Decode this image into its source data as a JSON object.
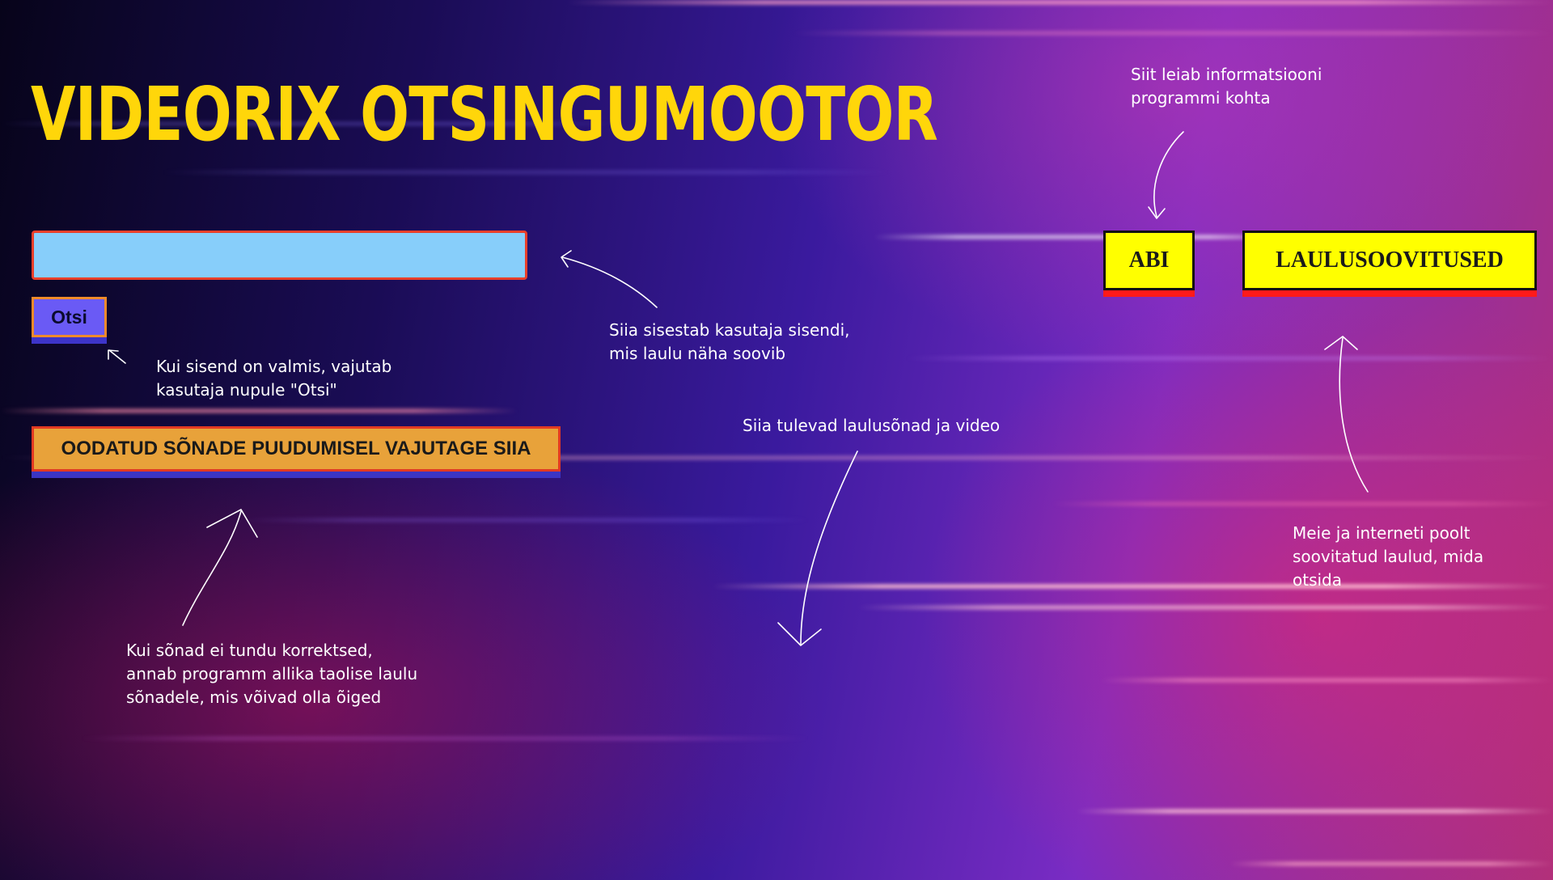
{
  "page": {
    "title": "VIDEORIX OTSINGUMOOTOR"
  },
  "search": {
    "value": "",
    "placeholder": ""
  },
  "buttons": {
    "search_label": "Otsi",
    "missing_words_label": "OODATUD SÕNADE PUUDUMISEL VAJUTAGE SIIA",
    "help_label": "ABI",
    "song_suggestions_label": "LAULUSOOVITUSED"
  },
  "annotations": {
    "help_info": [
      "Siit leiab informatsiooni",
      "programmi kohta"
    ],
    "search_input": [
      "Siia sisestab kasutaja sisendi,",
      "mis laulu näha soovib"
    ],
    "search_button": [
      "Kui sisend on valmis, vajutab",
      "kasutaja nupule \"Otsi\""
    ],
    "lyrics_video": [
      "Siia tulevad laulusõnad ja video"
    ],
    "suggestions": [
      "Meie ja interneti poolt",
      "soovitatud laulud, mida",
      "otsida"
    ],
    "missing_words": [
      "Kui sõnad ei tundu korrektsed,",
      "annab programm allika taolise laulu",
      "sõnadele, mis võivad olla õiged"
    ]
  },
  "colors": {
    "title": "#ffd60a",
    "search_field": "#87cefa",
    "search_button": "#6a5af5",
    "missing_words_button": "#e8a23a",
    "nav_buttons": "#ffff00",
    "nav_underline": "#ff1a1a"
  }
}
